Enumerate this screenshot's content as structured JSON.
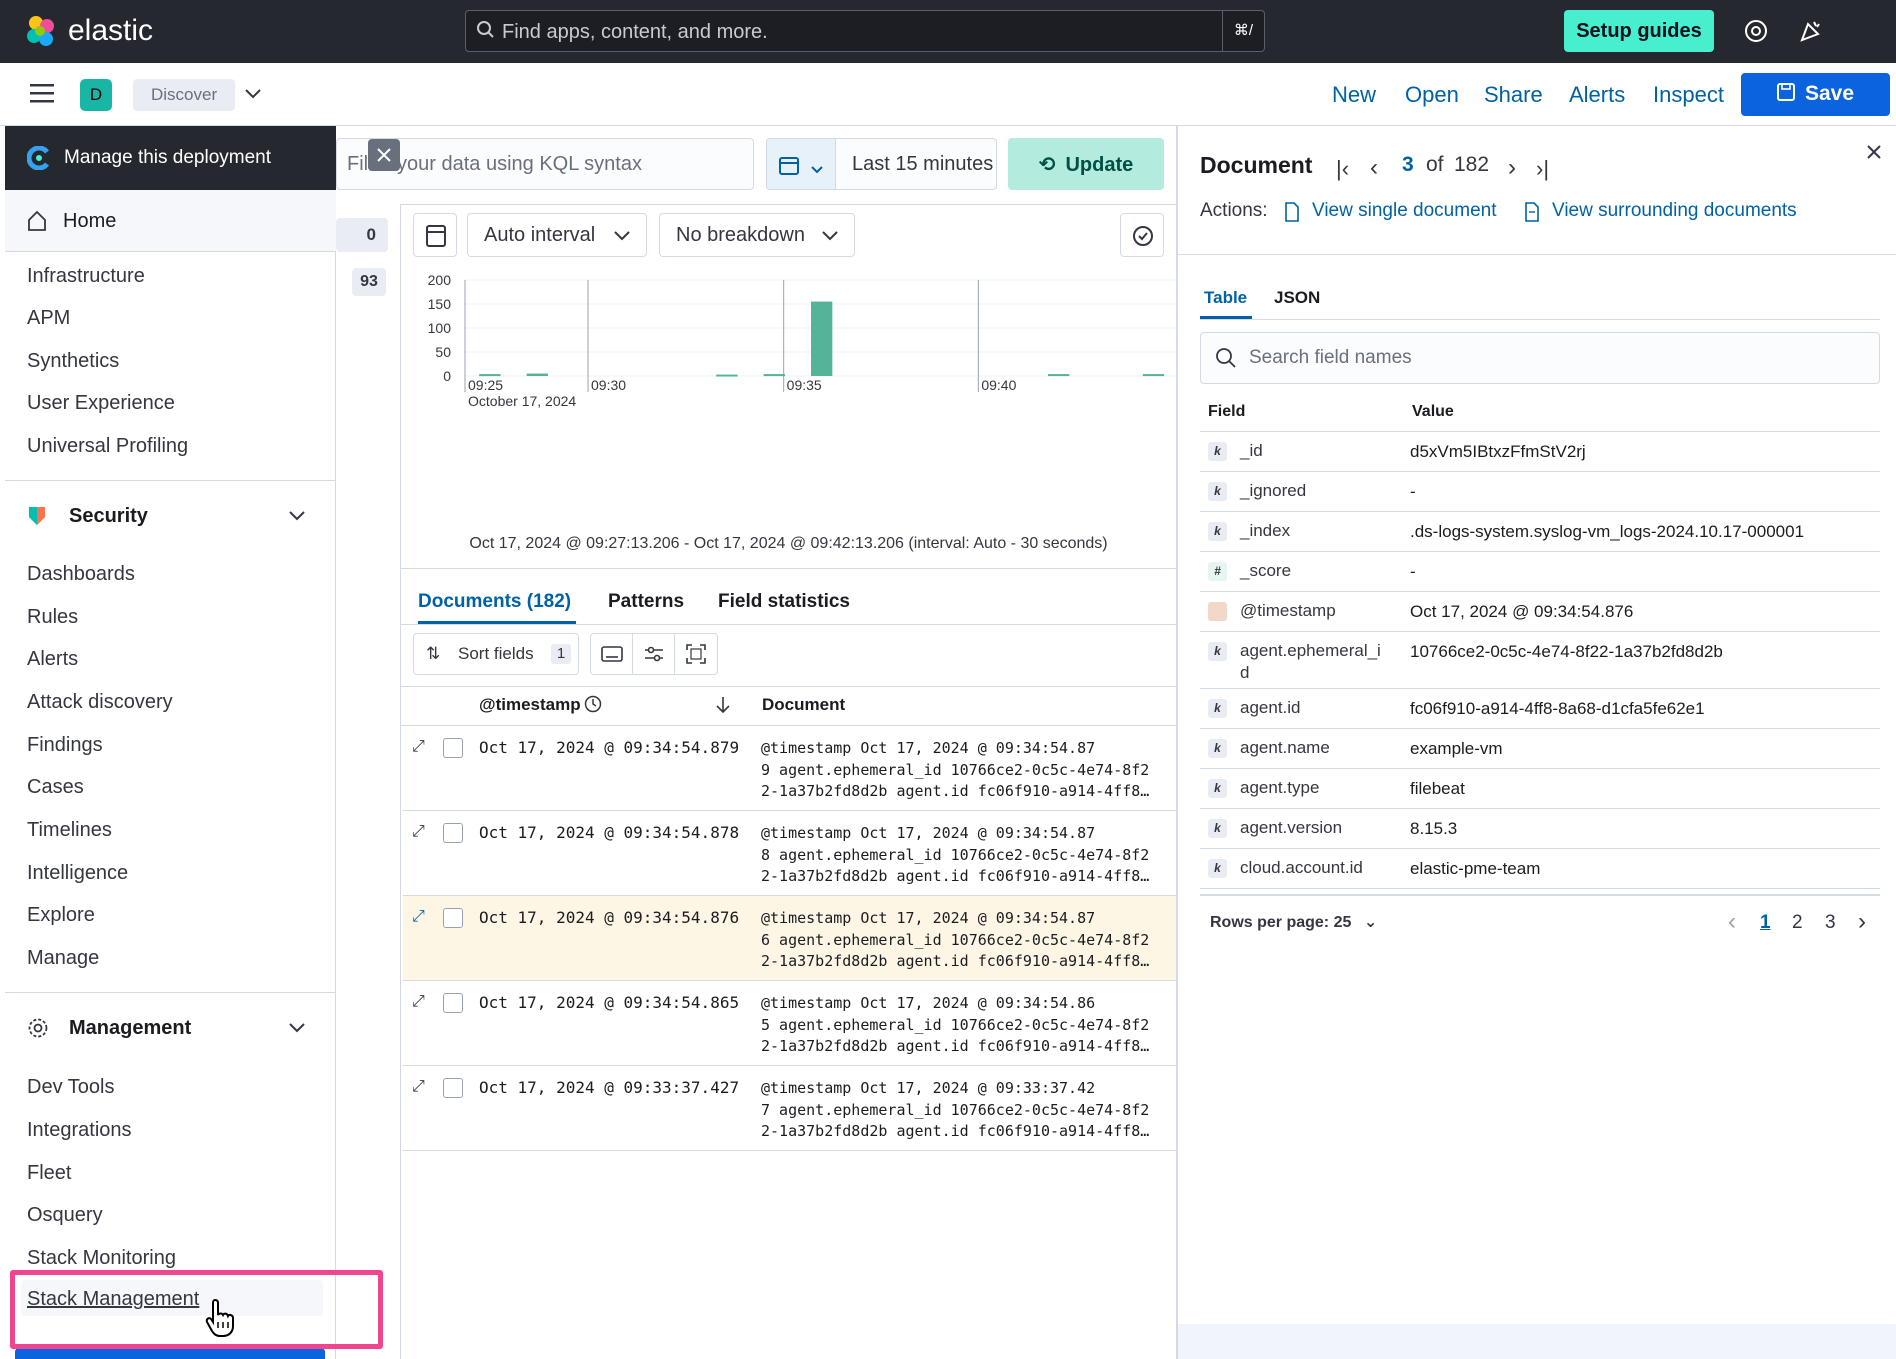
{
  "topbar": {
    "brand": "elastic",
    "search_placeholder": "Find apps, content, and more.",
    "search_shortcut": "⌘/",
    "setup_guides": "Setup guides"
  },
  "appbar": {
    "space_letter": "D",
    "breadcrumb": "Discover",
    "actions": [
      "New",
      "Open",
      "Share",
      "Alerts",
      "Inspect"
    ],
    "save": "Save"
  },
  "sidenav": {
    "deployment": "Manage this deployment",
    "home": "Home",
    "observability_items": [
      "Infrastructure",
      "APM",
      "Synthetics",
      "User Experience",
      "Universal Profiling"
    ],
    "security_title": "Security",
    "security_items": [
      "Dashboards",
      "Rules",
      "Alerts",
      "Attack discovery",
      "Findings",
      "Cases",
      "Timelines",
      "Intelligence",
      "Explore",
      "Manage"
    ],
    "management_title": "Management",
    "management_items": [
      "Dev Tools",
      "Integrations",
      "Fleet",
      "Osquery",
      "Stack Monitoring"
    ],
    "stack_management": "Stack Management"
  },
  "query": {
    "placeholder": "Filter your data using KQL syntax",
    "time_range": "Last 15 minutes",
    "update": "Update",
    "badge_count": "0",
    "badge_93": "93"
  },
  "chart_controls": {
    "interval": "Auto interval",
    "breakdown": "No breakdown"
  },
  "chart_data": {
    "type": "bar",
    "ylim": [
      0,
      200
    ],
    "yticks": [
      "200",
      "150",
      "100",
      "50",
      "0"
    ],
    "xticks": [
      "09:25",
      "09:30",
      "09:35",
      "09:40"
    ],
    "x_sublabel": "October 17, 2024",
    "values": [
      4,
      5,
      0,
      0,
      0,
      3,
      4,
      155,
      0,
      0,
      0,
      0,
      4,
      0,
      4
    ],
    "time_summary": "Oct 17, 2024 @ 09:27:13.206 - Oct 17, 2024 @ 09:42:13.206 (interval: Auto - 30 seconds)",
    "color": "#54b399"
  },
  "results": {
    "tabs": [
      "Documents (182)",
      "Patterns",
      "Field statistics"
    ],
    "sort_fields": "Sort fields",
    "sort_count": "1",
    "col_timestamp": "@timestamp",
    "col_document": "Document",
    "rows": [
      {
        "ts": "Oct 17, 2024 @ 09:34:54.879",
        "l1": "@timestamp Oct 17, 2024 @ 09:34:54.87",
        "l2": "9 agent.ephemeral_id 10766ce2-0c5c-4e74-8f2",
        "l3": "2-1a37b2fd8d2b agent.id fc06f910-a914-4ff8…"
      },
      {
        "ts": "Oct 17, 2024 @ 09:34:54.878",
        "l1": "@timestamp Oct 17, 2024 @ 09:34:54.87",
        "l2": "8 agent.ephemeral_id 10766ce2-0c5c-4e74-8f2",
        "l3": "2-1a37b2fd8d2b agent.id fc06f910-a914-4ff8…"
      },
      {
        "ts": "Oct 17, 2024 @ 09:34:54.876",
        "l1": "@timestamp Oct 17, 2024 @ 09:34:54.87",
        "l2": "6 agent.ephemeral_id 10766ce2-0c5c-4e74-8f2",
        "l3": "2-1a37b2fd8d2b agent.id fc06f910-a914-4ff8…"
      },
      {
        "ts": "Oct 17, 2024 @ 09:34:54.865",
        "l1": "@timestamp Oct 17, 2024 @ 09:34:54.86",
        "l2": "5 agent.ephemeral_id 10766ce2-0c5c-4e74-8f2",
        "l3": "2-1a37b2fd8d2b agent.id fc06f910-a914-4ff8…"
      },
      {
        "ts": "Oct 17, 2024 @ 09:33:37.427",
        "l1": "@timestamp Oct 17, 2024 @ 09:33:37.42",
        "l2": "7 agent.ephemeral_id 10766ce2-0c5c-4e74-8f2",
        "l3": "2-1a37b2fd8d2b agent.id fc06f910-a914-4ff8…"
      }
    ]
  },
  "flyout": {
    "title": "Document",
    "current": "3",
    "of": "of",
    "total": "182",
    "actions_label": "Actions:",
    "view_single": "View single document",
    "view_surrounding": "View surrounding documents",
    "tab_table": "Table",
    "tab_json": "JSON",
    "search_placeholder": "Search field names",
    "col_field": "Field",
    "col_value": "Value",
    "fields": [
      {
        "type": "k",
        "name": "_id",
        "value": "d5xVm5IBtxzFfmStV2rj"
      },
      {
        "type": "k",
        "name": "_ignored",
        "value": "-"
      },
      {
        "type": "k",
        "name": "_index",
        "value": ".ds-logs-system.syslog-vm_logs-2024.10.17-000001"
      },
      {
        "type": "#",
        "name": "_score",
        "value": "-"
      },
      {
        "type": "date",
        "name": "@timestamp",
        "value": "Oct 17, 2024 @ 09:34:54.876"
      },
      {
        "type": "k",
        "name": "agent.ephemeral_i\nd",
        "value": "10766ce2-0c5c-4e74-8f22-1a37b2fd8d2b"
      },
      {
        "type": "k",
        "name": "agent.id",
        "value": "fc06f910-a914-4ff8-8a68-d1cfa5fe62e1"
      },
      {
        "type": "k",
        "name": "agent.name",
        "value": "example-vm"
      },
      {
        "type": "k",
        "name": "agent.type",
        "value": "filebeat"
      },
      {
        "type": "k",
        "name": "agent.version",
        "value": "8.15.3"
      },
      {
        "type": "k",
        "name": "cloud.account.id",
        "value": "elastic-pme-team"
      }
    ],
    "rows_per_page": "Rows per page: 25",
    "pages": [
      "1",
      "2",
      "3"
    ]
  }
}
